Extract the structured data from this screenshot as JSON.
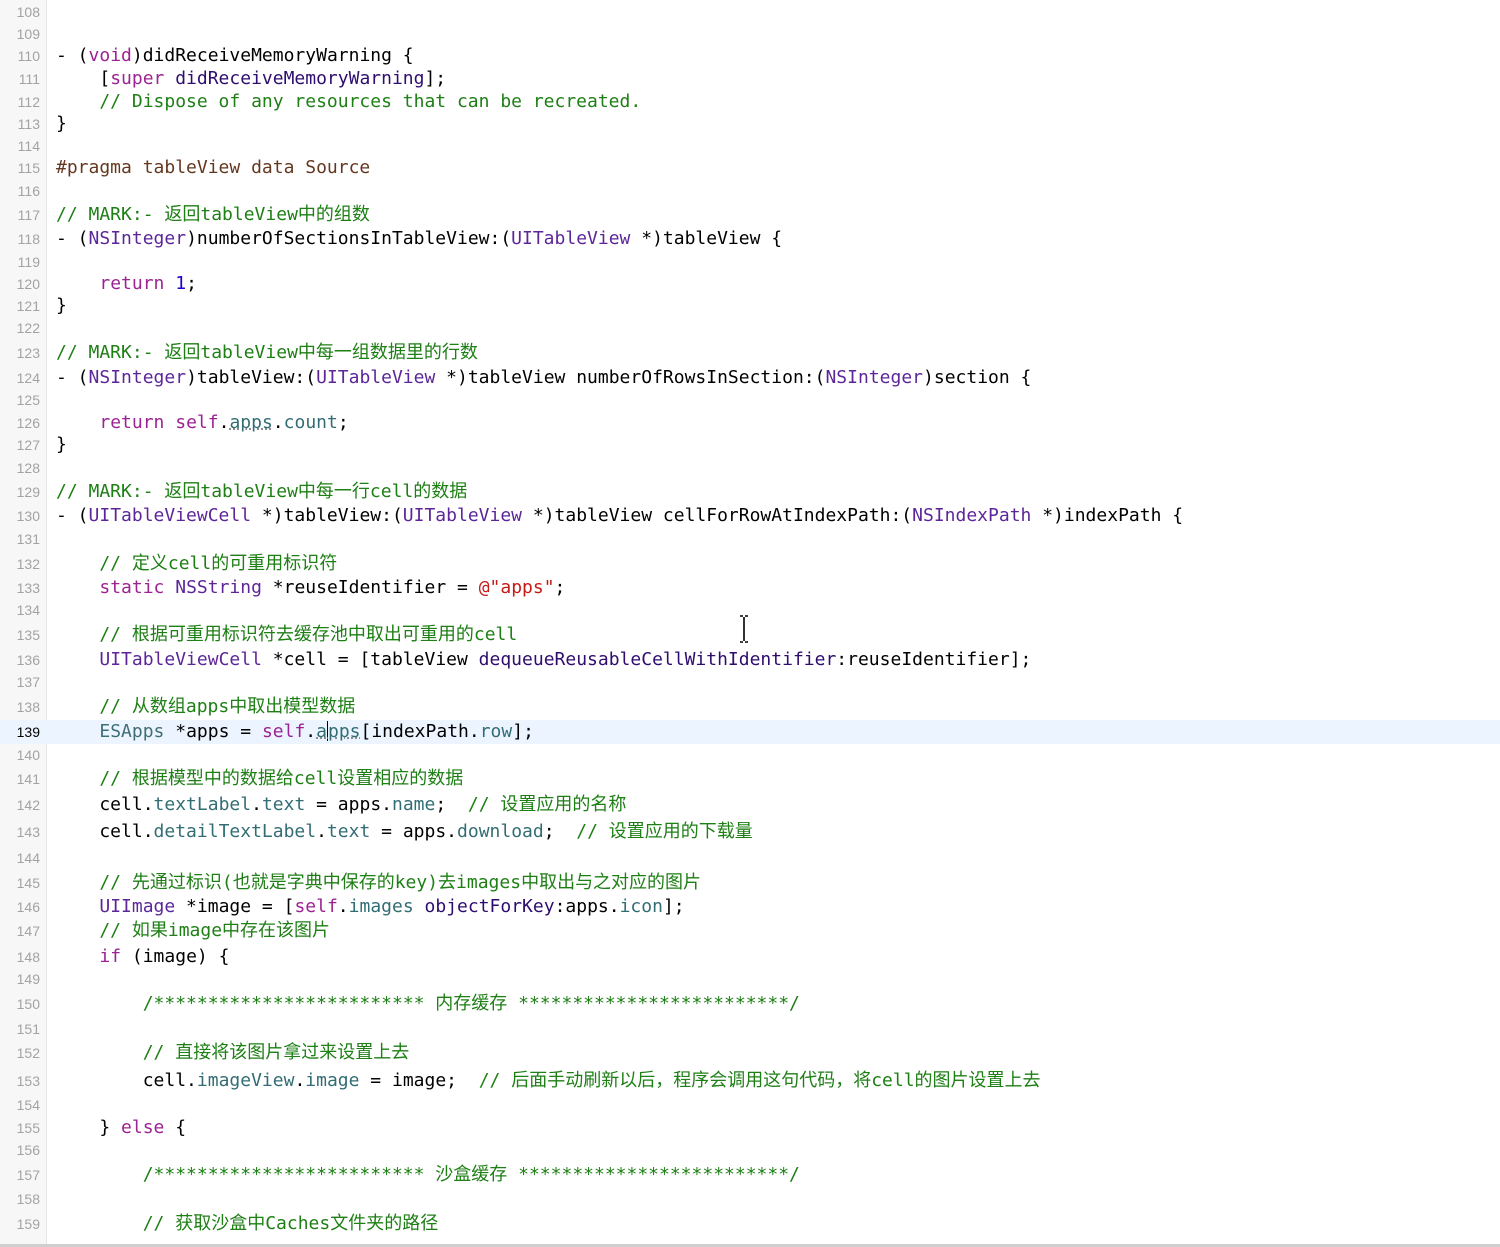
{
  "editor": {
    "current_line": "139",
    "lines": [
      {
        "num": "108",
        "tokens": []
      },
      {
        "num": "109",
        "tokens": []
      },
      {
        "num": "110",
        "tokens": [
          {
            "t": "- (",
            "c": "plain"
          },
          {
            "t": "void",
            "c": "kw"
          },
          {
            "t": ")didReceiveMemoryWarning {",
            "c": "plain"
          }
        ]
      },
      {
        "num": "111",
        "tokens": [
          {
            "t": "    [",
            "c": "plain"
          },
          {
            "t": "super",
            "c": "kw"
          },
          {
            "t": " didReceiveMemoryWarning",
            "c": "mth"
          },
          {
            "t": "];",
            "c": "plain"
          }
        ]
      },
      {
        "num": "112",
        "tokens": [
          {
            "t": "    // Dispose of any resources that can be recreated.",
            "c": "cmt"
          }
        ]
      },
      {
        "num": "113",
        "tokens": [
          {
            "t": "}",
            "c": "plain"
          }
        ]
      },
      {
        "num": "114",
        "tokens": []
      },
      {
        "num": "115",
        "tokens": [
          {
            "t": "#pragma tableView data Source",
            "c": "pre"
          }
        ]
      },
      {
        "num": "116",
        "tokens": []
      },
      {
        "num": "117",
        "tokens": [
          {
            "t": "// MARK:- 返回tableView中的组数",
            "c": "cmt"
          }
        ]
      },
      {
        "num": "118",
        "tokens": [
          {
            "t": "- (",
            "c": "plain"
          },
          {
            "t": "NSInteger",
            "c": "type"
          },
          {
            "t": ")numberOfSectionsInTableView:(",
            "c": "plain"
          },
          {
            "t": "UITableView",
            "c": "type"
          },
          {
            "t": " *)tableView {",
            "c": "plain"
          }
        ]
      },
      {
        "num": "119",
        "tokens": []
      },
      {
        "num": "120",
        "tokens": [
          {
            "t": "    ",
            "c": "plain"
          },
          {
            "t": "return",
            "c": "kw"
          },
          {
            "t": " ",
            "c": "plain"
          },
          {
            "t": "1",
            "c": "num"
          },
          {
            "t": ";",
            "c": "plain"
          }
        ]
      },
      {
        "num": "121",
        "tokens": [
          {
            "t": "}",
            "c": "plain"
          }
        ]
      },
      {
        "num": "122",
        "tokens": []
      },
      {
        "num": "123",
        "tokens": [
          {
            "t": "// MARK:- 返回tableView中每一组数据里的行数",
            "c": "cmt"
          }
        ]
      },
      {
        "num": "124",
        "tokens": [
          {
            "t": "- (",
            "c": "plain"
          },
          {
            "t": "NSInteger",
            "c": "type"
          },
          {
            "t": ")tableView:(",
            "c": "plain"
          },
          {
            "t": "UITableView",
            "c": "type"
          },
          {
            "t": " *)tableView numberOfRowsInSection:(",
            "c": "plain"
          },
          {
            "t": "NSInteger",
            "c": "type"
          },
          {
            "t": ")section {",
            "c": "plain"
          }
        ]
      },
      {
        "num": "125",
        "tokens": []
      },
      {
        "num": "126",
        "tokens": [
          {
            "t": "    ",
            "c": "plain"
          },
          {
            "t": "return",
            "c": "kw"
          },
          {
            "t": " ",
            "c": "plain"
          },
          {
            "t": "self",
            "c": "kw"
          },
          {
            "t": ".",
            "c": "plain"
          },
          {
            "t": "apps",
            "c": "prop",
            "issue": true
          },
          {
            "t": ".",
            "c": "plain"
          },
          {
            "t": "count",
            "c": "prop"
          },
          {
            "t": ";",
            "c": "plain"
          }
        ]
      },
      {
        "num": "127",
        "tokens": [
          {
            "t": "}",
            "c": "plain"
          }
        ]
      },
      {
        "num": "128",
        "tokens": []
      },
      {
        "num": "129",
        "tokens": [
          {
            "t": "// MARK:- 返回tableView中每一行cell的数据",
            "c": "cmt"
          }
        ]
      },
      {
        "num": "130",
        "tokens": [
          {
            "t": "- (",
            "c": "plain"
          },
          {
            "t": "UITableViewCell",
            "c": "type"
          },
          {
            "t": " *)tableView:(",
            "c": "plain"
          },
          {
            "t": "UITableView",
            "c": "type"
          },
          {
            "t": " *)tableView cellForRowAtIndexPath:(",
            "c": "plain"
          },
          {
            "t": "NSIndexPath",
            "c": "type"
          },
          {
            "t": " *)indexPath {",
            "c": "plain"
          }
        ]
      },
      {
        "num": "131",
        "tokens": []
      },
      {
        "num": "132",
        "tokens": [
          {
            "t": "    // 定义cell的可重用标识符",
            "c": "cmt"
          }
        ]
      },
      {
        "num": "133",
        "tokens": [
          {
            "t": "    ",
            "c": "plain"
          },
          {
            "t": "static",
            "c": "kw"
          },
          {
            "t": " ",
            "c": "plain"
          },
          {
            "t": "NSString",
            "c": "type"
          },
          {
            "t": " *reuseIdentifier = ",
            "c": "plain"
          },
          {
            "t": "@\"apps\"",
            "c": "str"
          },
          {
            "t": ";",
            "c": "plain"
          }
        ]
      },
      {
        "num": "134",
        "tokens": []
      },
      {
        "num": "135",
        "tokens": [
          {
            "t": "    // 根据可重用标识符去缓存池中取出可重用的cell",
            "c": "cmt"
          }
        ]
      },
      {
        "num": "136",
        "tokens": [
          {
            "t": "    ",
            "c": "plain"
          },
          {
            "t": "UITableViewCell",
            "c": "type"
          },
          {
            "t": " *cell = [tableView ",
            "c": "plain"
          },
          {
            "t": "dequeueReusableCellWithIdentifier",
            "c": "mth"
          },
          {
            "t": ":reuseIdentifier];",
            "c": "plain"
          }
        ]
      },
      {
        "num": "137",
        "tokens": []
      },
      {
        "num": "138",
        "tokens": [
          {
            "t": "    // 从数组apps中取出模型数据",
            "c": "cmt"
          }
        ]
      },
      {
        "num": "139",
        "tokens": [
          {
            "t": "    ",
            "c": "plain"
          },
          {
            "t": "ESApps",
            "c": "cls"
          },
          {
            "t": " *apps = ",
            "c": "plain"
          },
          {
            "t": "self",
            "c": "kw"
          },
          {
            "t": ".",
            "c": "plain"
          },
          {
            "t": "a",
            "c": "prop",
            "issue": true
          },
          {
            "caret": true
          },
          {
            "t": "pps",
            "c": "prop",
            "issue": true
          },
          {
            "t": "[indexPath.",
            "c": "plain"
          },
          {
            "t": "row",
            "c": "prop"
          },
          {
            "t": "];",
            "c": "plain"
          }
        ]
      },
      {
        "num": "140",
        "tokens": []
      },
      {
        "num": "141",
        "tokens": [
          {
            "t": "    // 根据模型中的数据给cell设置相应的数据",
            "c": "cmt"
          }
        ]
      },
      {
        "num": "142",
        "tokens": [
          {
            "t": "    cell.",
            "c": "plain"
          },
          {
            "t": "textLabel",
            "c": "prop"
          },
          {
            "t": ".",
            "c": "plain"
          },
          {
            "t": "text",
            "c": "prop"
          },
          {
            "t": " = apps.",
            "c": "plain"
          },
          {
            "t": "name",
            "c": "prop"
          },
          {
            "t": ";  ",
            "c": "plain"
          },
          {
            "t": "// 设置应用的名称",
            "c": "cmt"
          }
        ]
      },
      {
        "num": "143",
        "tokens": [
          {
            "t": "    cell.",
            "c": "plain"
          },
          {
            "t": "detailTextLabel",
            "c": "prop"
          },
          {
            "t": ".",
            "c": "plain"
          },
          {
            "t": "text",
            "c": "prop"
          },
          {
            "t": " = apps.",
            "c": "plain"
          },
          {
            "t": "download",
            "c": "prop"
          },
          {
            "t": ";  ",
            "c": "plain"
          },
          {
            "t": "// 设置应用的下载量",
            "c": "cmt"
          }
        ]
      },
      {
        "num": "144",
        "tokens": []
      },
      {
        "num": "145",
        "tokens": [
          {
            "t": "    // 先通过标识(也就是字典中保存的key)去images中取出与之对应的图片",
            "c": "cmt"
          }
        ]
      },
      {
        "num": "146",
        "tokens": [
          {
            "t": "    ",
            "c": "plain"
          },
          {
            "t": "UIImage",
            "c": "type"
          },
          {
            "t": " *image = [",
            "c": "plain"
          },
          {
            "t": "self",
            "c": "kw"
          },
          {
            "t": ".",
            "c": "plain"
          },
          {
            "t": "images",
            "c": "prop"
          },
          {
            "t": " ",
            "c": "plain"
          },
          {
            "t": "objectForKey",
            "c": "mth"
          },
          {
            "t": ":apps.",
            "c": "plain"
          },
          {
            "t": "icon",
            "c": "prop"
          },
          {
            "t": "];",
            "c": "plain"
          }
        ]
      },
      {
        "num": "147",
        "tokens": [
          {
            "t": "    // 如果image中存在该图片",
            "c": "cmt"
          }
        ]
      },
      {
        "num": "148",
        "tokens": [
          {
            "t": "    ",
            "c": "plain"
          },
          {
            "t": "if",
            "c": "kw"
          },
          {
            "t": " (image) {",
            "c": "plain"
          }
        ]
      },
      {
        "num": "149",
        "tokens": []
      },
      {
        "num": "150",
        "tokens": [
          {
            "t": "        /************************* 内存缓存 *************************/",
            "c": "cmt"
          }
        ]
      },
      {
        "num": "151",
        "tokens": []
      },
      {
        "num": "152",
        "tokens": [
          {
            "t": "        // 直接将该图片拿过来设置上去",
            "c": "cmt"
          }
        ]
      },
      {
        "num": "153",
        "tokens": [
          {
            "t": "        cell.",
            "c": "plain"
          },
          {
            "t": "imageView",
            "c": "prop"
          },
          {
            "t": ".",
            "c": "plain"
          },
          {
            "t": "image",
            "c": "prop"
          },
          {
            "t": " = image;  ",
            "c": "plain"
          },
          {
            "t": "// 后面手动刷新以后，程序会调用这句代码，将cell的图片设置上去",
            "c": "cmt"
          }
        ]
      },
      {
        "num": "154",
        "tokens": []
      },
      {
        "num": "155",
        "tokens": [
          {
            "t": "    } ",
            "c": "plain"
          },
          {
            "t": "else",
            "c": "kw"
          },
          {
            "t": " {",
            "c": "plain"
          }
        ]
      },
      {
        "num": "156",
        "tokens": []
      },
      {
        "num": "157",
        "tokens": [
          {
            "t": "        /************************* 沙盒缓存 *************************/",
            "c": "cmt"
          }
        ]
      },
      {
        "num": "158",
        "tokens": []
      },
      {
        "num": "159",
        "tokens": [
          {
            "t": "        // 获取沙盒中Caches文件夹的路径",
            "c": "cmt"
          }
        ]
      }
    ]
  }
}
